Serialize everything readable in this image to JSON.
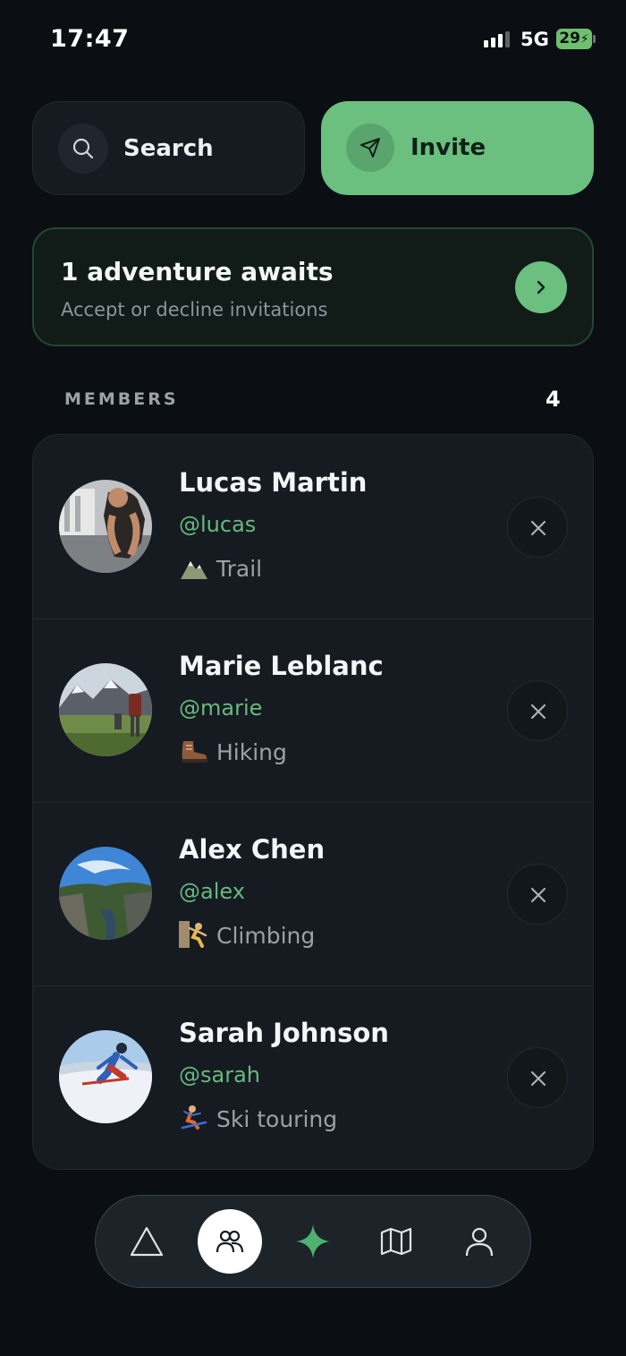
{
  "status_bar": {
    "time": "17:47",
    "network": "5G",
    "battery": "29"
  },
  "actions": {
    "search_label": "Search",
    "invite_label": "Invite"
  },
  "banner": {
    "title": "1 adventure awaits",
    "subtitle": "Accept or decline invitations"
  },
  "members_section": {
    "label": "MEMBERS",
    "count": "4"
  },
  "members": [
    {
      "name": "Lucas Martin",
      "handle": "@lucas",
      "activity": "Trail",
      "activity_icon": "mountain-icon"
    },
    {
      "name": "Marie Leblanc",
      "handle": "@marie",
      "activity": "Hiking",
      "activity_icon": "hiking-boot-icon"
    },
    {
      "name": "Alex Chen",
      "handle": "@alex",
      "activity": "Climbing",
      "activity_icon": "climber-icon"
    },
    {
      "name": "Sarah Johnson",
      "handle": "@sarah",
      "activity": "Ski touring",
      "activity_icon": "skier-icon"
    }
  ],
  "nav": {
    "items": [
      "adventures-icon",
      "members-icon",
      "sparkle-icon",
      "map-icon",
      "profile-icon"
    ],
    "active": "members-icon"
  },
  "colors": {
    "accent": "#6bbf7f",
    "background": "#0b0f14",
    "card": "#151b21"
  }
}
